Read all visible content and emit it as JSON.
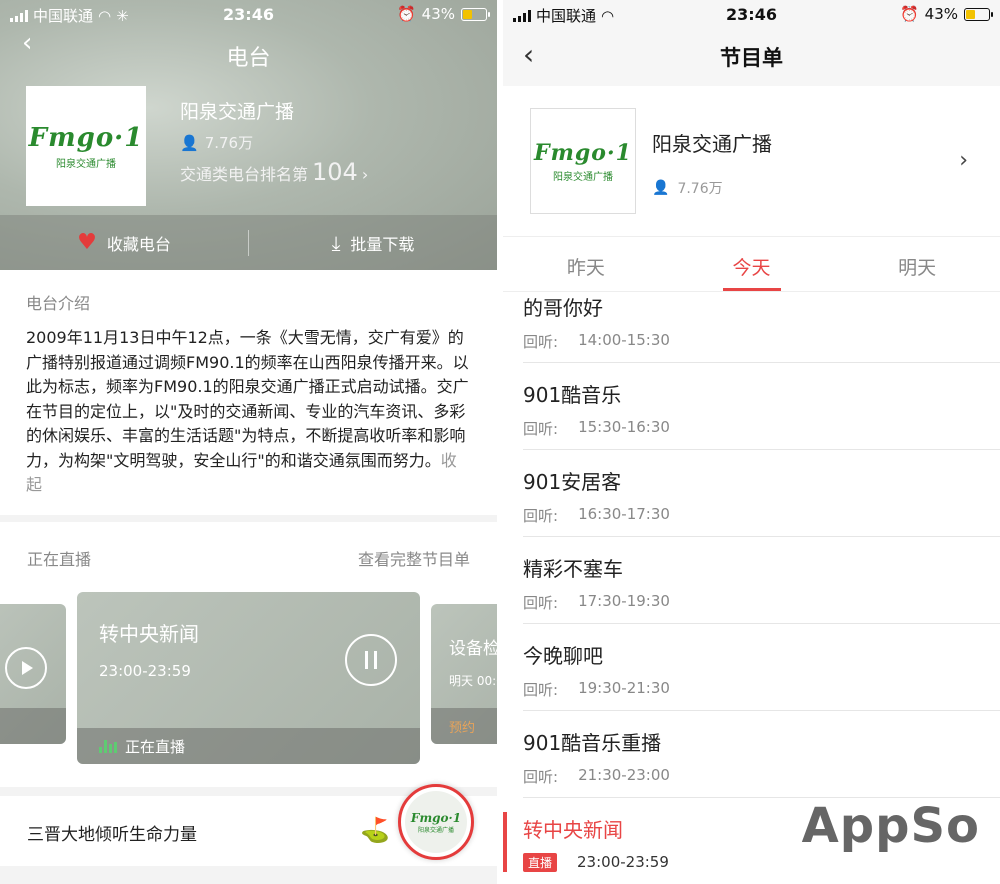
{
  "status_left": {
    "carrier": "中国联通",
    "time": "23:46",
    "battery": "43%"
  },
  "status_right": {
    "carrier": "中国联通",
    "time": "23:46",
    "battery": "43%"
  },
  "left": {
    "header_title": "电台",
    "station": {
      "name": "阳泉交通广播",
      "listeners": "7.76万",
      "rank_label": "交通类电台排名第",
      "rank_value": "104"
    },
    "logo": {
      "fm_text": "Fmgo·1",
      "cn_text": "阳泉交通广播"
    },
    "actions": {
      "favorite": "收藏电台",
      "download": "批量下载"
    },
    "intro": {
      "label": "电台介绍",
      "text": "2009年11月13日中午12点，一条《大雪无情，交广有爱》的广播特别报道通过调频FM90.1的频率在山西阳泉传播开来。以此为标志，频率为FM90.1的阳泉交通广播正式启动试播。交广在节目的定位上，以\"及时的交通新闻、专业的汽车资讯、多彩的休闲娱乐、丰富的生活话题\"为特点，不断提高收听率和影响力，为构架\"文明驾驶，安全山行\"的和谐交通氛围而努力。",
      "collapse": "收起"
    },
    "live": {
      "label": "正在直播",
      "full_schedule": "查看完整节目单",
      "current": {
        "title": "转中央新闻",
        "time": "23:00-23:59",
        "status": "正在直播"
      },
      "next": {
        "title": "设备检",
        "sub": "明天 00:0",
        "action": "预约"
      }
    },
    "footer": {
      "text": "三晋大地倾听生命力量",
      "mini_fm": "Fmgo·1",
      "mini_cn": "阳泉交通广播"
    }
  },
  "right": {
    "header_title": "节目单",
    "station": {
      "name": "阳泉交通广播",
      "listeners": "7.76万"
    },
    "logo": {
      "fm_text": "Fmgo·1",
      "cn_text": "阳泉交通广播"
    },
    "tabs": [
      "昨天",
      "今天",
      "明天"
    ],
    "active_tab": 1,
    "programs": [
      {
        "name": "的哥你好",
        "tag": "回听:",
        "time": "14:00-15:30"
      },
      {
        "name": "901酷音乐",
        "tag": "回听:",
        "time": "15:30-16:30"
      },
      {
        "name": "901安居客",
        "tag": "回听:",
        "time": "16:30-17:30"
      },
      {
        "name": "精彩不塞车",
        "tag": "回听:",
        "time": "17:30-19:30"
      },
      {
        "name": "今晚聊吧",
        "tag": "回听:",
        "time": "19:30-21:30"
      },
      {
        "name": "901酷音乐重播",
        "tag": "回听:",
        "time": "21:30-23:00"
      },
      {
        "name": "转中央新闻",
        "tag": "直播",
        "time": "23:00-23:59"
      }
    ],
    "watermark": "AppSo"
  },
  "colors": {
    "accent_red": "#e84545",
    "logo_green": "#2a8a2e",
    "live_green": "#5ecb72"
  }
}
